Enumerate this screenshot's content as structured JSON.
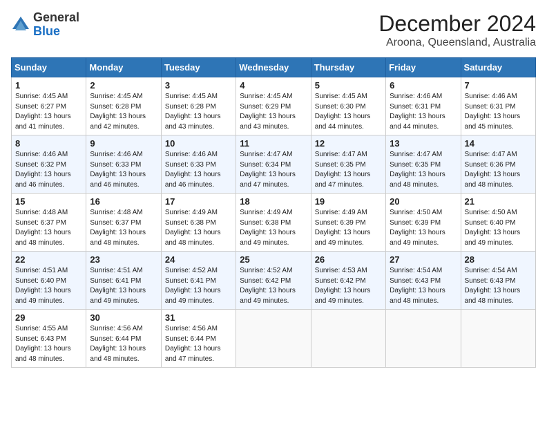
{
  "logo": {
    "general": "General",
    "blue": "Blue"
  },
  "title": "December 2024",
  "subtitle": "Aroona, Queensland, Australia",
  "days_of_week": [
    "Sunday",
    "Monday",
    "Tuesday",
    "Wednesday",
    "Thursday",
    "Friday",
    "Saturday"
  ],
  "weeks": [
    [
      {
        "day": "1",
        "info": "Sunrise: 4:45 AM\nSunset: 6:27 PM\nDaylight: 13 hours\nand 41 minutes."
      },
      {
        "day": "2",
        "info": "Sunrise: 4:45 AM\nSunset: 6:28 PM\nDaylight: 13 hours\nand 42 minutes."
      },
      {
        "day": "3",
        "info": "Sunrise: 4:45 AM\nSunset: 6:28 PM\nDaylight: 13 hours\nand 43 minutes."
      },
      {
        "day": "4",
        "info": "Sunrise: 4:45 AM\nSunset: 6:29 PM\nDaylight: 13 hours\nand 43 minutes."
      },
      {
        "day": "5",
        "info": "Sunrise: 4:45 AM\nSunset: 6:30 PM\nDaylight: 13 hours\nand 44 minutes."
      },
      {
        "day": "6",
        "info": "Sunrise: 4:46 AM\nSunset: 6:31 PM\nDaylight: 13 hours\nand 44 minutes."
      },
      {
        "day": "7",
        "info": "Sunrise: 4:46 AM\nSunset: 6:31 PM\nDaylight: 13 hours\nand 45 minutes."
      }
    ],
    [
      {
        "day": "8",
        "info": "Sunrise: 4:46 AM\nSunset: 6:32 PM\nDaylight: 13 hours\nand 46 minutes."
      },
      {
        "day": "9",
        "info": "Sunrise: 4:46 AM\nSunset: 6:33 PM\nDaylight: 13 hours\nand 46 minutes."
      },
      {
        "day": "10",
        "info": "Sunrise: 4:46 AM\nSunset: 6:33 PM\nDaylight: 13 hours\nand 46 minutes."
      },
      {
        "day": "11",
        "info": "Sunrise: 4:47 AM\nSunset: 6:34 PM\nDaylight: 13 hours\nand 47 minutes."
      },
      {
        "day": "12",
        "info": "Sunrise: 4:47 AM\nSunset: 6:35 PM\nDaylight: 13 hours\nand 47 minutes."
      },
      {
        "day": "13",
        "info": "Sunrise: 4:47 AM\nSunset: 6:35 PM\nDaylight: 13 hours\nand 48 minutes."
      },
      {
        "day": "14",
        "info": "Sunrise: 4:47 AM\nSunset: 6:36 PM\nDaylight: 13 hours\nand 48 minutes."
      }
    ],
    [
      {
        "day": "15",
        "info": "Sunrise: 4:48 AM\nSunset: 6:37 PM\nDaylight: 13 hours\nand 48 minutes."
      },
      {
        "day": "16",
        "info": "Sunrise: 4:48 AM\nSunset: 6:37 PM\nDaylight: 13 hours\nand 48 minutes."
      },
      {
        "day": "17",
        "info": "Sunrise: 4:49 AM\nSunset: 6:38 PM\nDaylight: 13 hours\nand 48 minutes."
      },
      {
        "day": "18",
        "info": "Sunrise: 4:49 AM\nSunset: 6:38 PM\nDaylight: 13 hours\nand 49 minutes."
      },
      {
        "day": "19",
        "info": "Sunrise: 4:49 AM\nSunset: 6:39 PM\nDaylight: 13 hours\nand 49 minutes."
      },
      {
        "day": "20",
        "info": "Sunrise: 4:50 AM\nSunset: 6:39 PM\nDaylight: 13 hours\nand 49 minutes."
      },
      {
        "day": "21",
        "info": "Sunrise: 4:50 AM\nSunset: 6:40 PM\nDaylight: 13 hours\nand 49 minutes."
      }
    ],
    [
      {
        "day": "22",
        "info": "Sunrise: 4:51 AM\nSunset: 6:40 PM\nDaylight: 13 hours\nand 49 minutes."
      },
      {
        "day": "23",
        "info": "Sunrise: 4:51 AM\nSunset: 6:41 PM\nDaylight: 13 hours\nand 49 minutes."
      },
      {
        "day": "24",
        "info": "Sunrise: 4:52 AM\nSunset: 6:41 PM\nDaylight: 13 hours\nand 49 minutes."
      },
      {
        "day": "25",
        "info": "Sunrise: 4:52 AM\nSunset: 6:42 PM\nDaylight: 13 hours\nand 49 minutes."
      },
      {
        "day": "26",
        "info": "Sunrise: 4:53 AM\nSunset: 6:42 PM\nDaylight: 13 hours\nand 49 minutes."
      },
      {
        "day": "27",
        "info": "Sunrise: 4:54 AM\nSunset: 6:43 PM\nDaylight: 13 hours\nand 48 minutes."
      },
      {
        "day": "28",
        "info": "Sunrise: 4:54 AM\nSunset: 6:43 PM\nDaylight: 13 hours\nand 48 minutes."
      }
    ],
    [
      {
        "day": "29",
        "info": "Sunrise: 4:55 AM\nSunset: 6:43 PM\nDaylight: 13 hours\nand 48 minutes."
      },
      {
        "day": "30",
        "info": "Sunrise: 4:56 AM\nSunset: 6:44 PM\nDaylight: 13 hours\nand 48 minutes."
      },
      {
        "day": "31",
        "info": "Sunrise: 4:56 AM\nSunset: 6:44 PM\nDaylight: 13 hours\nand 47 minutes."
      },
      null,
      null,
      null,
      null
    ]
  ]
}
